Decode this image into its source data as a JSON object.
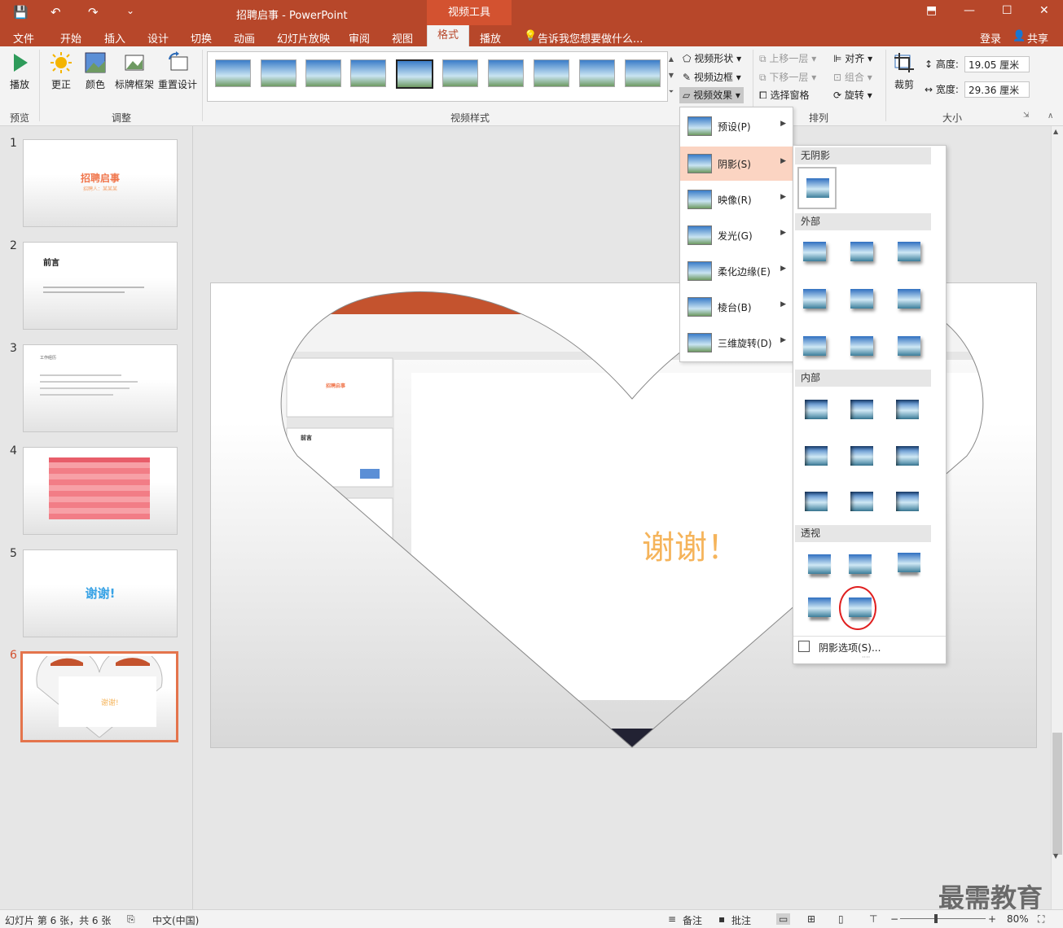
{
  "titlebar": {
    "title": "招聘启事 - PowerPoint",
    "context_tools": "视频工具",
    "qa_save": "💾",
    "qa_undo": "↶",
    "qa_redo": "↷",
    "qa_more": "⌄",
    "win_ribbon": "⬒",
    "win_min": "—",
    "win_max": "☐",
    "win_close": "✕"
  },
  "tabs": {
    "file": "文件",
    "home": "开始",
    "insert": "插入",
    "design": "设计",
    "transitions": "切换",
    "animations": "动画",
    "slideshow": "幻灯片放映",
    "review": "审阅",
    "view": "视图",
    "format": "格式",
    "playback": "播放",
    "tell_me": "告诉我您想要做什么...",
    "login": "登录",
    "share": "共享"
  },
  "ribbon": {
    "play_label": "播放",
    "group_preview": "预览",
    "correct_label": "更正",
    "color_label": "颜色",
    "poster_label": "标牌框架",
    "reset_label": "重置设计",
    "group_adjust": "调整",
    "group_styles": "视频样式",
    "video_shape": "视频形状",
    "video_border": "视频边框",
    "video_effects": "视频效果",
    "bring_forward": "上移一层",
    "send_backward": "下移一层",
    "selection_pane": "选择窗格",
    "align": "对齐",
    "group": "组合",
    "rotate": "旋转",
    "group_arrange": "排列",
    "crop": "裁剪",
    "height_label": "高度:",
    "height_value": "19.05 厘米",
    "width_label": "宽度:",
    "width_value": "29.36 厘米",
    "group_size": "大小"
  },
  "slides": [
    {
      "num": "1",
      "title": "招聘启事",
      "sub": "招聘人：某某某"
    },
    {
      "num": "2",
      "title": "前言"
    },
    {
      "num": "3",
      "title": "工作经历"
    },
    {
      "num": "4"
    },
    {
      "num": "5",
      "title": "谢谢!"
    },
    {
      "num": "6",
      "title": "谢谢!"
    }
  ],
  "main_slide": {
    "text": "谢谢！"
  },
  "effects_menu": {
    "preset": "预设(P)",
    "shadow": "阴影(S)",
    "reflection": "映像(R)",
    "glow": "发光(G)",
    "soft_edges": "柔化边缘(E)",
    "bevel": "棱台(B)",
    "rotation_3d": "三维旋转(D)"
  },
  "shadow_menu": {
    "no_shadow": "无阴影",
    "outer": "外部",
    "inner": "内部",
    "perspective": "透视",
    "options": "阴影选项(S)..."
  },
  "status": {
    "slide_info": "幻灯片 第 6 张，共 6 张",
    "language": "中文(中国)",
    "notes": "备注",
    "comments": "批注",
    "zoom": "80%"
  },
  "watermark": "最需教育",
  "colors": {
    "accent": "#b7472a",
    "highlight": "#fbd4c2",
    "selected_border": "#e4744c",
    "annotation_circle": "#e02020"
  }
}
